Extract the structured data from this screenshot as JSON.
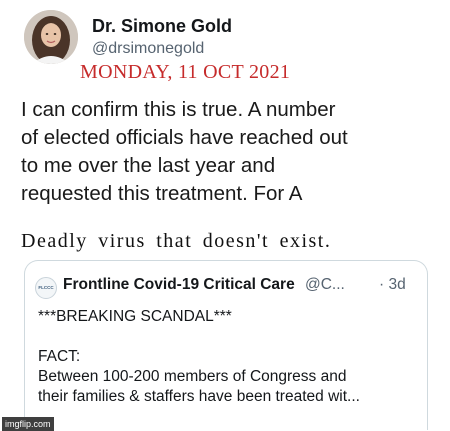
{
  "tweet": {
    "author_name": "Dr. Simone Gold",
    "author_handle": "@drsimonegold",
    "avatar_icon": "profile-photo-icon",
    "text_lines": [
      "I can confirm this is true. A number",
      "of elected officials have reached out",
      "to me over the last year and",
      "requested this treatment."
    ],
    "added_text_tail": "For A",
    "added_text_line": "Deadly virus that doesn't exist."
  },
  "date_overlay": "MONDAY, 11 OCT 2021",
  "quoted_tweet": {
    "avatar_text": "FLCCC",
    "author_name": "Frontline Covid-19 Critical Care",
    "author_handle": "@C...",
    "time": "· 3d",
    "lines": [
      "***BREAKING SCANDAL***",
      "",
      "FACT:",
      "Between 100-200 members of Congress and",
      "their families & staffers have been treated wit..."
    ]
  },
  "watermark": "imgflip.com",
  "colors": {
    "date_overlay": "#c62b2b",
    "handle_gray": "#566370",
    "card_border": "#cfd9de"
  }
}
